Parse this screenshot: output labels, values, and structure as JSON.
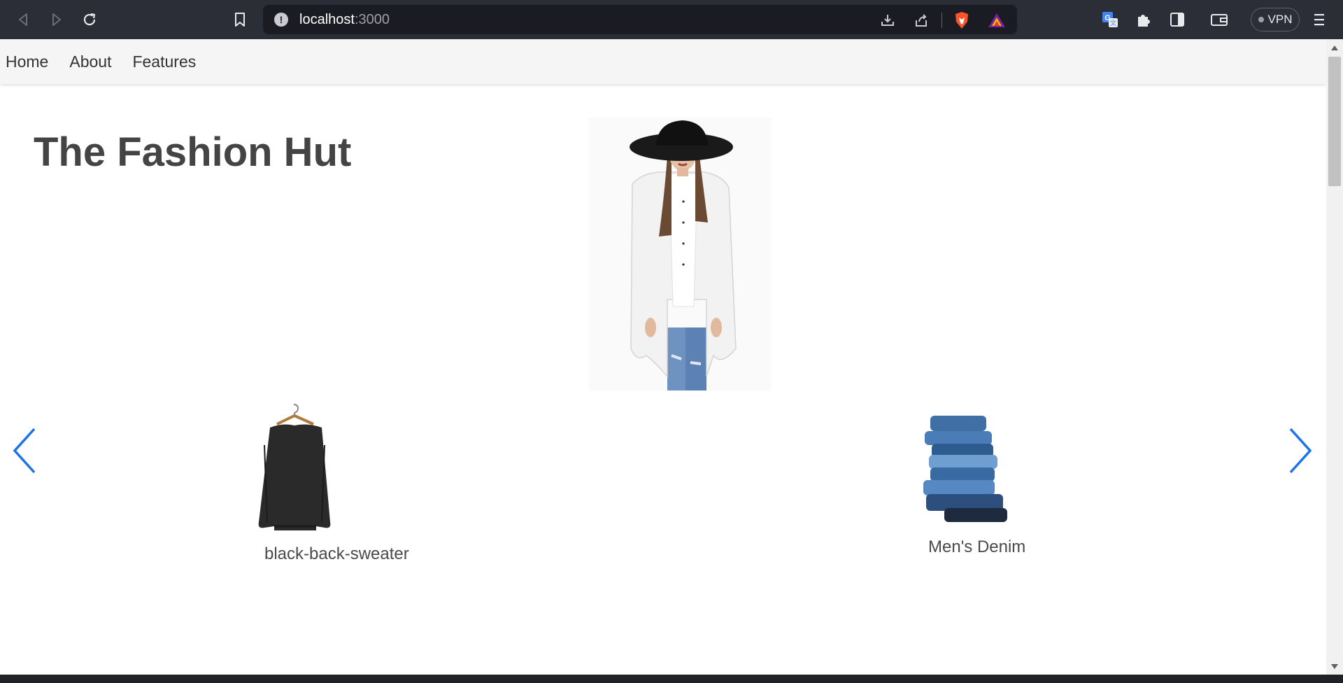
{
  "browser": {
    "url_host": "localhost",
    "url_port": ":3000",
    "vpn_label": "VPN",
    "icons": [
      "back-icon",
      "forward-icon",
      "reload-icon",
      "bookmark-icon",
      "site-info-icon",
      "download-icon",
      "share-icon",
      "brave-shields-icon",
      "brave-rewards-icon",
      "translate-icon",
      "extensions-icon",
      "sidebar-icon",
      "wallet-icon",
      "menu-icon"
    ]
  },
  "nav": {
    "items": [
      {
        "label": "Home"
      },
      {
        "label": "About"
      },
      {
        "label": "Features"
      }
    ]
  },
  "page": {
    "title": "The Fashion Hut"
  },
  "carousel": {
    "products": [
      {
        "label": "black-back-sweater"
      },
      {
        "label": "Men's Denim"
      }
    ]
  },
  "colors": {
    "carousel_arrow": "#1a73e8",
    "chrome_bg": "#2b2d37"
  }
}
